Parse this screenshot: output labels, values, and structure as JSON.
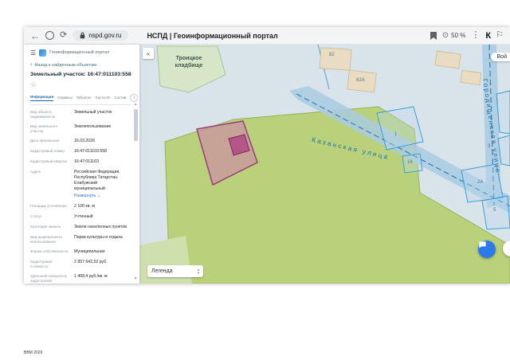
{
  "browser": {
    "back_icon": "←",
    "refresh_icon": "⟳",
    "url": "nspd.gov.ru",
    "page_title": "НСПД | Геоинформационный портал",
    "zoom_icon": "⊙",
    "zoom_level": "50 %",
    "menu_icon": "⋮",
    "extension_k": "К",
    "flag_icon": "⚐"
  },
  "sidebar": {
    "brand": "Геоинформационный портал",
    "back_link": "Назад к найденным объектам",
    "object_title": "Земельный участок: 16:47:011103:558",
    "star_icon": "☆",
    "tabs": [
      "Информация",
      "Сервисы",
      "Объекты",
      "Части ЗУ",
      "Состав"
    ],
    "tabs_arrow": "›",
    "fields": [
      {
        "label": "Вид объекта недвижимости",
        "value": "Земельный участок"
      },
      {
        "label": "Вид земельного участка",
        "value": "Землепользование"
      },
      {
        "label": "Дата присвоения",
        "value": "16.03.2026"
      },
      {
        "label": "Кадастровый номер",
        "value": "16:47:011103:558"
      },
      {
        "label": "Кадастровый квартал",
        "value": "16:47:011103"
      },
      {
        "label": "Адрес",
        "value": "Российская Федерация, Республика Татарстан, Елабужский муниципальный"
      },
      {
        "label": "Площадь уточненная",
        "value": "2 100 кв. м"
      },
      {
        "label": "Статус",
        "value": "Учтенный"
      },
      {
        "label": "Категория земель",
        "value": "Земли населенных пунктов"
      },
      {
        "label": "Вид разрешенного использования",
        "value": "Парки культуры и отдыха"
      },
      {
        "label": "Форма собственности",
        "value": "Муниципальная"
      },
      {
        "label": "Кадастровая стоимость",
        "value": "2 857 642,52 руб."
      },
      {
        "label": "Удельный показатель кадастровой",
        "value": "1 408,4 руб./кв. м"
      }
    ],
    "address_expand": "Развернуть ⌄"
  },
  "map": {
    "collapse_icon": "«",
    "login_label": "Вой",
    "legend_label": "Легенда",
    "cemetery_line1": "Троицкое",
    "cemetery_line2": "кладбище",
    "street_1": "Казанская улица",
    "street_2": "Городищенская улица",
    "numbers": [
      "82",
      "82А",
      "1",
      "4",
      "3",
      "16",
      "2А",
      "5"
    ]
  },
  "footer": {
    "watermark": "ВВМ 2026"
  },
  "colors": {
    "accent_blue": "#2a7be8",
    "selected_parcel": "#d17baf",
    "park_green": "#b9d17b",
    "road_blue": "#a9cbe2"
  }
}
